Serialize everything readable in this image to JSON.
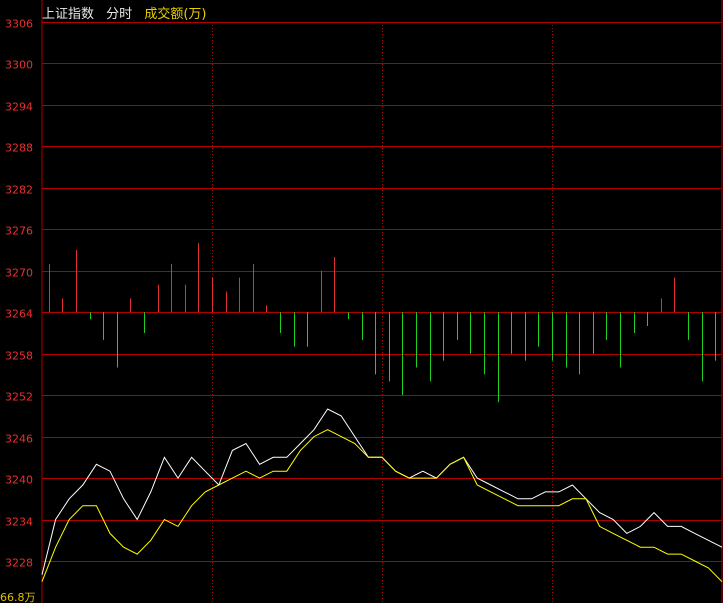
{
  "header": {
    "title": "上证指数",
    "mode": "分时",
    "indicator": "成交额(万)"
  },
  "bottom_label": "66.8万",
  "colors": {
    "background": "#000000",
    "grid": "#b00000",
    "axis_text": "#e83030",
    "price_line": "#ffffff",
    "avg_line": "#ffff00",
    "bar_up": "#e03030",
    "bar_down": "#20d020"
  },
  "chart_data": {
    "type": "line",
    "ylim": [
      3224,
      3306
    ],
    "baseline": 3264,
    "y_ticks": [
      "3306",
      "3300",
      "3294",
      "3288",
      "3282",
      "3276",
      "3270",
      "3264",
      "3258",
      "3252",
      "3246",
      "3240",
      "3234",
      "3228"
    ],
    "x_range": [
      0,
      100
    ],
    "series": [
      {
        "role": "price",
        "x": [
          0,
          2,
          4,
          6,
          8,
          10,
          12,
          14,
          16,
          18,
          20,
          22,
          24,
          26,
          28,
          30,
          32,
          34,
          36,
          38,
          40,
          42,
          44,
          46,
          48,
          50,
          52,
          54,
          56,
          58,
          60,
          62,
          64,
          66,
          68,
          70,
          72,
          74,
          76,
          78,
          80,
          82,
          84,
          86,
          88,
          90,
          92,
          94,
          96,
          98,
          100
        ],
        "values": [
          3226,
          3234,
          3237,
          3239,
          3242,
          3241,
          3237,
          3234,
          3238,
          3243,
          3240,
          3243,
          3241,
          3239,
          3244,
          3245,
          3242,
          3243,
          3243,
          3245,
          3247,
          3250,
          3249,
          3246,
          3243,
          3243,
          3241,
          3240,
          3241,
          3240,
          3242,
          3243,
          3240,
          3239,
          3238,
          3237,
          3237,
          3238,
          3238,
          3239,
          3237,
          3235,
          3234,
          3232,
          3233,
          3235,
          3233,
          3233,
          3232,
          3231,
          3230
        ]
      },
      {
        "role": "average",
        "x": [
          0,
          2,
          4,
          6,
          8,
          10,
          12,
          14,
          16,
          18,
          20,
          22,
          24,
          26,
          28,
          30,
          32,
          34,
          36,
          38,
          40,
          42,
          44,
          46,
          48,
          50,
          52,
          54,
          56,
          58,
          60,
          62,
          64,
          66,
          68,
          70,
          72,
          74,
          76,
          78,
          80,
          82,
          84,
          86,
          88,
          90,
          92,
          94,
          96,
          98,
          100
        ],
        "values": [
          3225,
          3230,
          3234,
          3236,
          3236,
          3232,
          3230,
          3229,
          3231,
          3234,
          3233,
          3236,
          3238,
          3239,
          3240,
          3241,
          3240,
          3241,
          3241,
          3244,
          3246,
          3247,
          3246,
          3245,
          3243,
          3243,
          3241,
          3240,
          3240,
          3240,
          3242,
          3243,
          3239,
          3238,
          3237,
          3236,
          3236,
          3236,
          3236,
          3237,
          3237,
          3233,
          3232,
          3231,
          3230,
          3230,
          3229,
          3229,
          3228,
          3227,
          3225
        ]
      }
    ],
    "bars": {
      "x": [
        1,
        3,
        5,
        7,
        9,
        11,
        13,
        15,
        17,
        19,
        21,
        23,
        25,
        27,
        29,
        31,
        33,
        35,
        37,
        39,
        41,
        43,
        45,
        47,
        49,
        51,
        53,
        55,
        57,
        59,
        61,
        63,
        65,
        67,
        69,
        71,
        73,
        75,
        77,
        79,
        81,
        83,
        85,
        87,
        89,
        91,
        93,
        95,
        97,
        99
      ],
      "values": [
        7,
        2,
        9,
        -1,
        -4,
        -8,
        2,
        -3,
        4,
        7,
        4,
        10,
        5,
        3,
        5,
        7,
        1,
        -3,
        -5,
        -5,
        6,
        8,
        -1,
        -4,
        -9,
        -10,
        -12,
        -8,
        -10,
        -7,
        -4,
        -6,
        -9,
        -13,
        -6,
        -7,
        -5,
        -7,
        -8,
        -9,
        -6,
        -4,
        -8,
        -3,
        -2,
        2,
        5,
        -4,
        -10,
        -7
      ]
    }
  }
}
